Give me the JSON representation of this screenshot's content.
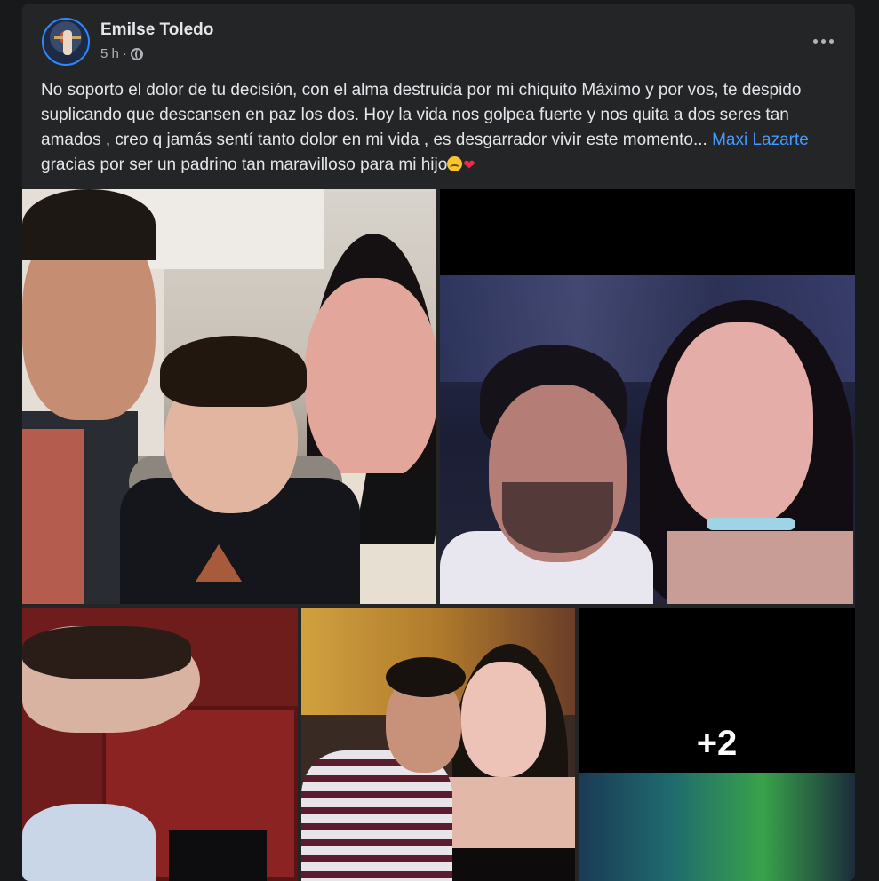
{
  "post": {
    "author": "Emilse Toledo",
    "time": "5 h",
    "separator": "·",
    "text_before_mention": "No soporto el dolor de tu decisión, con el alma destruida por  mi chiquito Máximo y por vos, te despido suplicando que descansen en paz los dos. Hoy la vida nos golpea fuerte y nos quita a dos seres tan amados , creo q jamás sentí tanto dolor en mi vida , es desgarrador vivir este momento... ",
    "mention": "Maxi Lazarte",
    "text_after_mention": " gracias por ser un padrino tan maravilloso para mi hijo",
    "emoji_heart": "❤"
  },
  "photos": {
    "more_count": "+2"
  },
  "colors": {
    "background": "#18191a",
    "card": "#242526",
    "text": "#e4e6eb",
    "secondary_text": "#b0b3b8",
    "link": "#4599ff"
  }
}
